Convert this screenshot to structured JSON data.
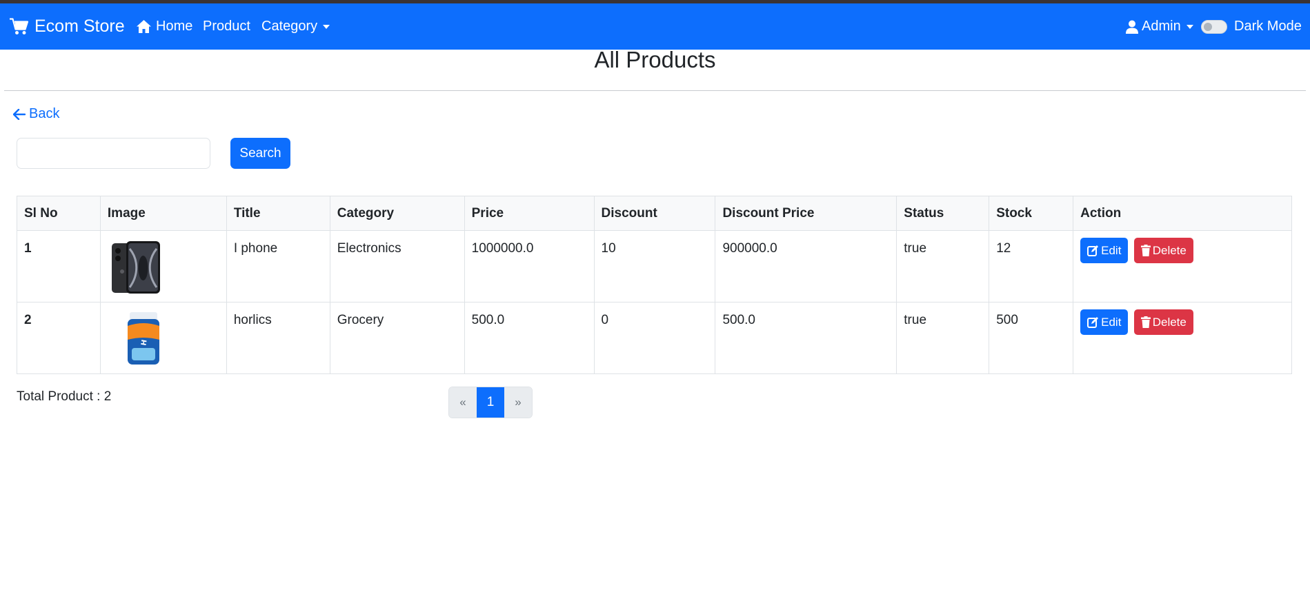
{
  "navbar": {
    "brand": "Ecom Store",
    "links": {
      "home": "Home",
      "product": "Product",
      "category": "Category"
    },
    "user": "Admin",
    "dark_mode": "Dark Mode",
    "color": "#0d6efd"
  },
  "page": {
    "title": "All Products",
    "back": "Back"
  },
  "search": {
    "button": "Search",
    "value": "",
    "placeholder": ""
  },
  "table": {
    "headers": [
      "Sl No",
      "Image",
      "Title",
      "Category",
      "Price",
      "Discount",
      "Discount Price",
      "Status",
      "Stock",
      "Action"
    ],
    "rows": [
      {
        "sl": "1",
        "image": "phone-image",
        "title": "I phone",
        "category": "Electronics",
        "price": "1000000.0",
        "discount": "10",
        "discount_price": "900000.0",
        "status": "true",
        "stock": "12"
      },
      {
        "sl": "2",
        "image": "horlicks-jar-image",
        "title": "horlics",
        "category": "Grocery",
        "price": "500.0",
        "discount": "0",
        "discount_price": "500.0",
        "status": "true",
        "stock": "500"
      }
    ],
    "actions": {
      "edit": "Edit",
      "delete": "Delete"
    }
  },
  "footer": {
    "total": "Total Product : 2"
  },
  "pagination": {
    "prev": "«",
    "current": "1",
    "next": "»"
  },
  "colors": {
    "primary": "#0d6efd",
    "danger": "#dc3545"
  }
}
